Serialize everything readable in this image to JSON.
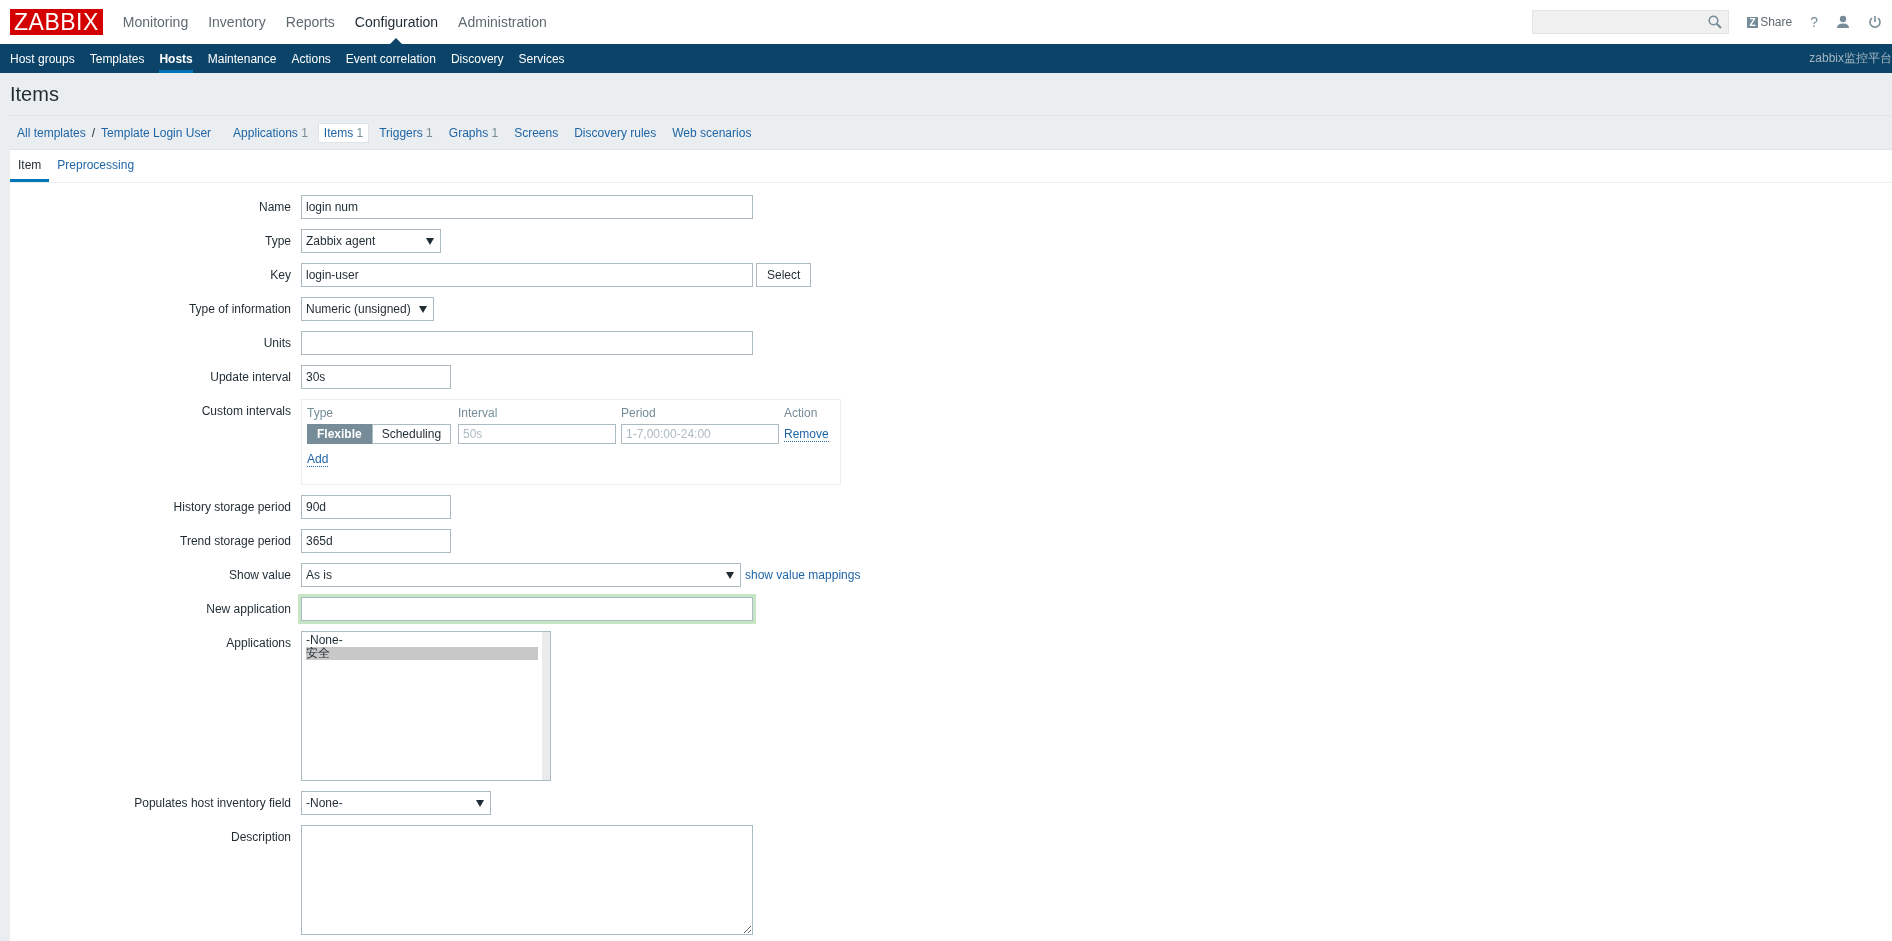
{
  "header": {
    "logo": "ZABBIX",
    "menu": [
      {
        "label": "Monitoring",
        "selected": false
      },
      {
        "label": "Inventory",
        "selected": false
      },
      {
        "label": "Reports",
        "selected": false
      },
      {
        "label": "Configuration",
        "selected": true
      },
      {
        "label": "Administration",
        "selected": false
      }
    ],
    "share_badge": "Z",
    "share": "Share",
    "help": "?"
  },
  "subnav": {
    "items": [
      {
        "label": "Host groups",
        "selected": false
      },
      {
        "label": "Templates",
        "selected": false
      },
      {
        "label": "Hosts",
        "selected": true
      },
      {
        "label": "Maintenance",
        "selected": false
      },
      {
        "label": "Actions",
        "selected": false
      },
      {
        "label": "Event correlation",
        "selected": false
      },
      {
        "label": "Discovery",
        "selected": false
      },
      {
        "label": "Services",
        "selected": false
      }
    ],
    "server_name": "zabbix监控平台"
  },
  "page_title": "Items",
  "breadcrumbs": [
    "All templates",
    "Template Login User"
  ],
  "breadcrumb_separator": "/",
  "object_tabs": [
    {
      "label": "Applications",
      "count": "1",
      "selected": false
    },
    {
      "label": "Items",
      "count": "1",
      "selected": true
    },
    {
      "label": "Triggers",
      "count": "1",
      "selected": false
    },
    {
      "label": "Graphs",
      "count": "1",
      "selected": false
    },
    {
      "label": "Screens",
      "selected": false
    },
    {
      "label": "Discovery rules",
      "selected": false
    },
    {
      "label": "Web scenarios",
      "selected": false
    }
  ],
  "form_tabs": [
    {
      "label": "Item",
      "selected": true
    },
    {
      "label": "Preprocessing",
      "selected": false
    }
  ],
  "fields": [
    {
      "kind": "text",
      "label": "Name",
      "value": "login num"
    },
    {
      "kind": "select",
      "label": "Type",
      "value": "Zabbix agent"
    },
    {
      "kind": "text",
      "label": "Key",
      "value": "login-user",
      "button": "Select"
    },
    {
      "kind": "select",
      "label": "Type of information",
      "value": "Numeric (unsigned)"
    },
    {
      "kind": "text",
      "label": "Units"
    },
    {
      "kind": "text",
      "label": "Update interval",
      "value": "30s"
    },
    {
      "kind": "intervals",
      "label": "Custom intervals",
      "columns": [
        "Type",
        "Interval",
        "Period",
        "Action"
      ],
      "rows": [
        {
          "modes": [
            {
              "label": "Flexible",
              "selected": true
            },
            {
              "label": "Scheduling",
              "selected": false
            }
          ],
          "interval_placeholder": "50s",
          "period_placeholder": "1-7,00:00-24:00",
          "action": "Remove"
        }
      ],
      "add": "Add"
    },
    {
      "kind": "text",
      "label": "History storage period",
      "value": "90d"
    },
    {
      "kind": "text",
      "label": "Trend storage period",
      "value": "365d"
    },
    {
      "kind": "select",
      "label": "Show value",
      "value": "As is",
      "link": "show value mappings"
    },
    {
      "kind": "text",
      "label": "New application",
      "focused": true
    },
    {
      "kind": "listbox",
      "label": "Applications",
      "options": [
        {
          "label": "-None-",
          "selected": false
        },
        {
          "label": "安全",
          "selected": true
        }
      ]
    },
    {
      "kind": "select",
      "label": "Populates host inventory field",
      "value": "-None-"
    },
    {
      "kind": "textarea",
      "label": "Description"
    }
  ]
}
